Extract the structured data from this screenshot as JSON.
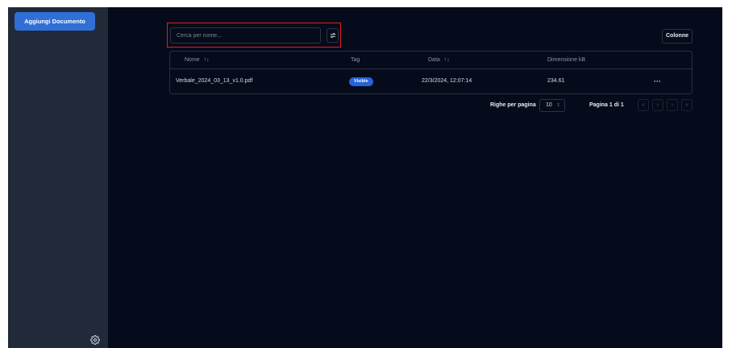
{
  "sidebar": {
    "add_button_label": "Aggiungi Documento",
    "settings_icon": "gear-icon"
  },
  "search": {
    "placeholder": "Cerca per nome...",
    "value": "",
    "filter_icon": "sliders-icon"
  },
  "toolbar": {
    "columns_label": "Colonne"
  },
  "table": {
    "columns": [
      {
        "label": "Nome",
        "sortable": true
      },
      {
        "label": "Tag",
        "sortable": false
      },
      {
        "label": "Data",
        "sortable": true
      },
      {
        "label": "Dimensione kB",
        "sortable": false
      }
    ],
    "sort_icon": "↑↓",
    "rows": [
      {
        "name": "Verbale_2024_03_13_v1.0.pdf",
        "tag": "Visible",
        "date": "22/3/2024, 12:07:14",
        "size": "234.61",
        "actions": "···"
      }
    ]
  },
  "pagination": {
    "rows_per_page_label": "Righe per pagina",
    "rows_per_page_value": "10",
    "page_info": "Pagina 1 di 1",
    "first": "«",
    "prev": "‹",
    "next": "›",
    "last": "»"
  },
  "colors": {
    "background": "#050b1a",
    "sidebar": "#212a38",
    "accent": "#2f6fd6",
    "badge": "#2563d8",
    "highlight": "#e11d21"
  }
}
